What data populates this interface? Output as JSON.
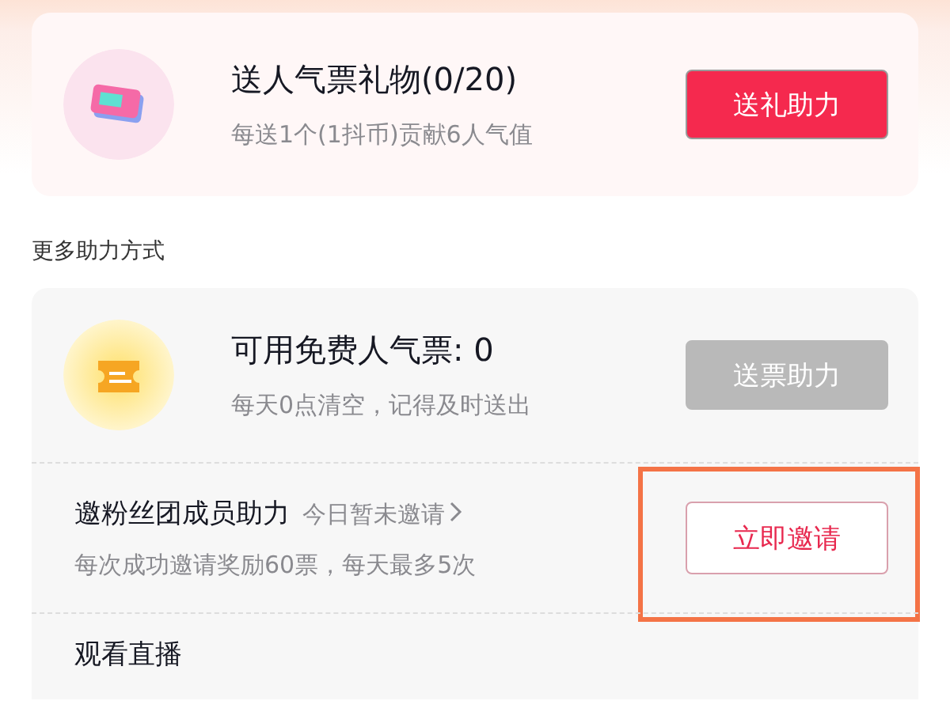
{
  "gift": {
    "title": "送人气票礼物(0/20)",
    "subtitle": "每送1个(1抖币)贡献6人气值",
    "button": {
      "label": "送礼助力",
      "kind": "filled",
      "disabled": false
    }
  },
  "section_title": "更多助力方式",
  "tasks": [
    {
      "kind": "ticket",
      "title": "可用免费人气票: 0",
      "subtitle": "每天0点清空，记得及时送出",
      "button": {
        "label": "送票助力",
        "kind": "filled",
        "disabled": true,
        "highlighted": false
      }
    },
    {
      "kind": "plain",
      "title": "邀粉丝团成员助力",
      "hint": "今日暂未邀请",
      "subtitle": "每次成功邀请奖励60票，每天最多5次",
      "button": {
        "label": "立即邀请",
        "kind": "outline",
        "disabled": false,
        "highlighted": true
      }
    },
    {
      "kind": "plain",
      "title": "观看直播"
    }
  ]
}
